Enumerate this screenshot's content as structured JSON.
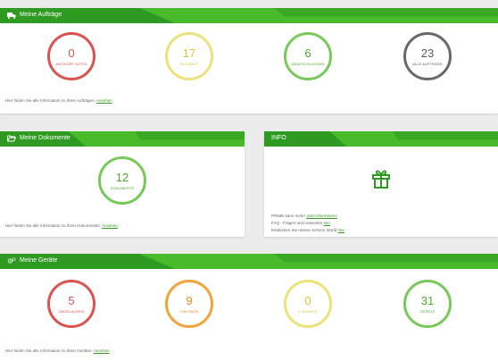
{
  "orders": {
    "title": "Meine Aufträge",
    "circles": [
      {
        "number": "0",
        "label": "ANTWORT NÖTIG"
      },
      {
        "number": "17",
        "label": "IN ARBEIT"
      },
      {
        "number": "6",
        "label": "ABGESCHLOSSEN"
      },
      {
        "number": "23",
        "label": "ALLE AUFTRÄGE"
      }
    ],
    "info": "Hier finden Sie alle Information zu Ihren Aufträgen:",
    "link": "Ansehen"
  },
  "documents": {
    "title": "Meine Dokumente",
    "circle": {
      "number": "12",
      "label": "DOKUMENTE"
    },
    "info": "Hier finden Sie alle Information zu Ihren Dokumenten:",
    "link": "Ansehen"
  },
  "info_panel": {
    "title": "INFO",
    "icon": "gift-icon",
    "line1_text": "PRIME kann mehr!",
    "line1_link": "Jetzt informieren!",
    "line2_text": "FAQ - Fragen und Antworten",
    "line2_link": "hier",
    "line3_text": "Entdecken Sie unsere Service World",
    "line3_link": "hier"
  },
  "devices": {
    "title": "Meine Geräte",
    "circles": [
      {
        "number": "5",
        "label": "ABGELAUFEN"
      },
      {
        "number": "9",
        "label": "3 MONATE"
      },
      {
        "number": "0",
        "label": "6 MONATE"
      },
      {
        "number": "31",
        "label": "GERÄTE"
      }
    ],
    "info": "Hier finden Sie alle Information zu Ihren Geräten:",
    "link": "Ansehen"
  },
  "colors": {
    "header_green": "#2f9a22",
    "red": "#d9534f",
    "yellow": "#ece27a",
    "green": "#78c85a",
    "grey": "#666a6e",
    "orange": "#f0a43a"
  }
}
